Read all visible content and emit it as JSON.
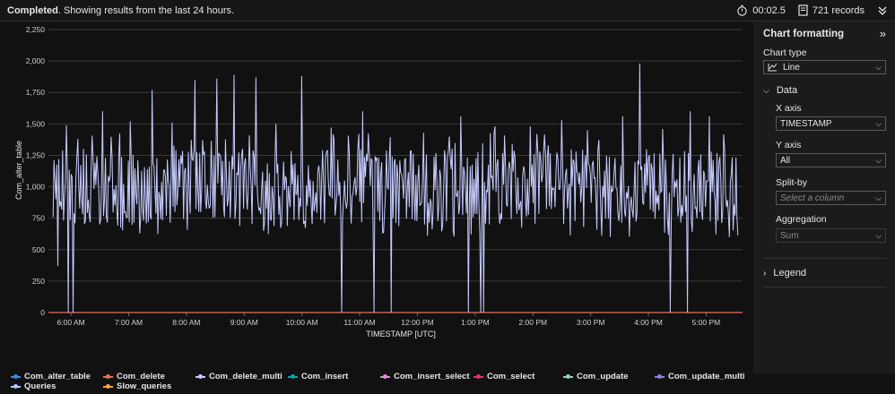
{
  "status": {
    "bold": "Completed",
    "text": ". Showing results from the last 24 hours."
  },
  "toolbar": {
    "time": "00:02.5",
    "records": "721 records"
  },
  "chart_data": {
    "type": "line",
    "ylabel": "Com_alter_table",
    "xlabel": "TIMESTAMP [UTC]",
    "ylim": [
      0,
      2250
    ],
    "y_ticks": [
      "0",
      "250",
      "500",
      "750",
      "1,000",
      "1,250",
      "1,500",
      "1,750",
      "2,000",
      "2,250"
    ],
    "x_ticks": [
      "6:00 AM",
      "7:00 AM",
      "8:00 AM",
      "9:00 AM",
      "10:00 AM",
      "11:00 AM",
      "12:00 PM",
      "1:00 PM",
      "2:00 PM",
      "3:00 PM",
      "4:00 PM",
      "5:00 PM"
    ],
    "x_range_hours": [
      5.61,
      17.63
    ],
    "grid": true,
    "series": [
      {
        "name": "Com_alter_table",
        "color": "#c5cbff",
        "typical_range": [
          700,
          1300
        ],
        "spikes": [
          [
            5.92,
            1490
          ],
          [
            6.12,
            1380
          ],
          [
            6.55,
            1600
          ],
          [
            7.03,
            1520
          ],
          [
            7.4,
            1770
          ],
          [
            7.75,
            1510
          ],
          [
            8.15,
            1850
          ],
          [
            8.52,
            1860
          ],
          [
            8.82,
            1890
          ],
          [
            9.2,
            1870
          ],
          [
            9.55,
            1500
          ],
          [
            10.0,
            1880
          ],
          [
            10.5,
            1470
          ],
          [
            11.05,
            1600
          ],
          [
            11.55,
            1420
          ],
          [
            12.1,
            1430
          ],
          [
            12.75,
            1560
          ],
          [
            13.35,
            1480
          ],
          [
            13.95,
            1480
          ],
          [
            14.5,
            1530
          ],
          [
            14.95,
            1450
          ],
          [
            15.55,
            1560
          ],
          [
            15.85,
            1980
          ],
          [
            16.25,
            1460
          ],
          [
            16.72,
            1600
          ],
          [
            17.05,
            1560
          ]
        ],
        "dips": [
          [
            5.96,
            0
          ],
          [
            6.03,
            0
          ],
          [
            5.78,
            370
          ],
          [
            10.68,
            0
          ],
          [
            11.25,
            0
          ],
          [
            11.55,
            0
          ],
          [
            12.88,
            0
          ],
          [
            13.1,
            0
          ],
          [
            13.15,
            0
          ],
          [
            16.38,
            0
          ],
          [
            16.68,
            0
          ],
          [
            17.4,
            600
          ]
        ]
      },
      {
        "name": "Com_delete",
        "color": "#e8715d",
        "flat": 0
      }
    ]
  },
  "legend": [
    {
      "name": "Com_alter_table",
      "color": "#3b8de0"
    },
    {
      "name": "Com_delete",
      "color": "#e8715d"
    },
    {
      "name": "Com_delete_multi",
      "color": "#c5cbff"
    },
    {
      "name": "Com_insert",
      "color": "#0aa5a5"
    },
    {
      "name": "Com_insert_select",
      "color": "#e58ae0"
    },
    {
      "name": "Com_select",
      "color": "#e0307a"
    },
    {
      "name": "Com_update",
      "color": "#9bd0b0"
    },
    {
      "name": "Com_update_multi",
      "color": "#8b82e0"
    },
    {
      "name": "Queries",
      "color": "#b8c4ff"
    },
    {
      "name": "Slow_queries",
      "color": "#f2a64a"
    }
  ],
  "panel": {
    "title": "Chart formatting",
    "chart_type_label": "Chart type",
    "chart_type_value": "Line",
    "data_section": "Data",
    "x_axis_label": "X axis",
    "x_axis_value": "TIMESTAMP",
    "y_axis_label": "Y axis",
    "y_axis_value": "All",
    "split_by_label": "Split-by",
    "split_by_placeholder": "Select a column",
    "aggregation_label": "Aggregation",
    "aggregation_value": "Sum",
    "legend_section": "Legend"
  }
}
